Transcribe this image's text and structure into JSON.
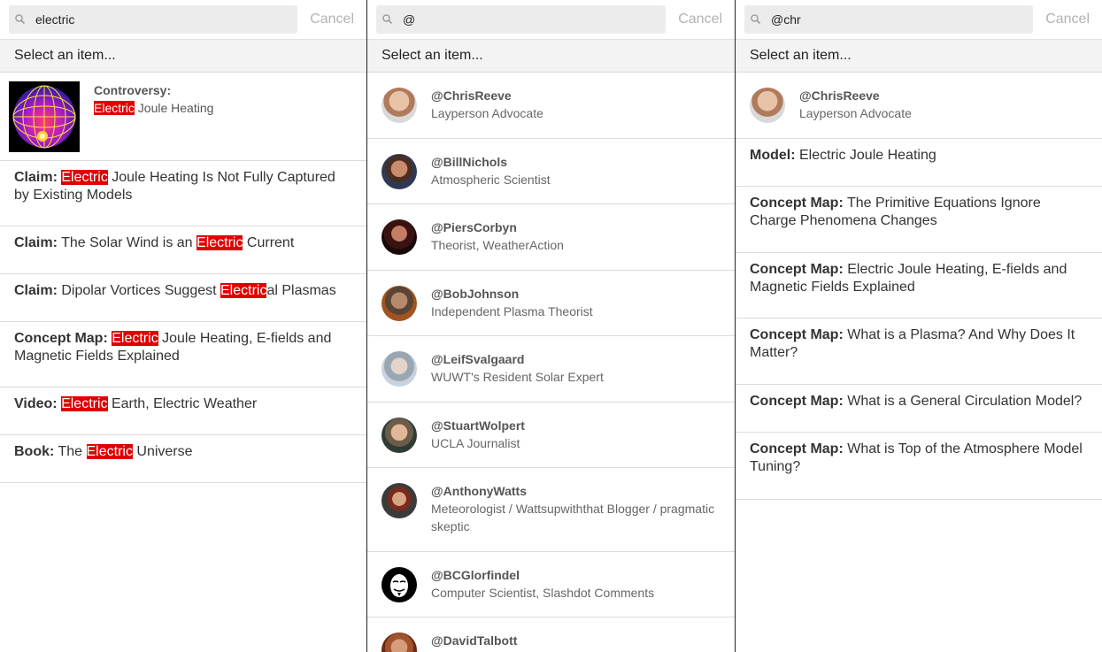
{
  "panels": [
    {
      "search": {
        "value": "electric",
        "cancel": "Cancel"
      },
      "header": "Select an item...",
      "controversy": {
        "label": "Controversy:",
        "hl": "Electric",
        "rest": " Joule Heating"
      },
      "items": [
        {
          "type": "Claim:",
          "pre": " ",
          "hl": "Electric",
          "post": " Joule Heating Is Not Fully Captured by Existing Models"
        },
        {
          "type": "Claim:",
          "pre": " The Solar Wind is an ",
          "hl": "Electric",
          "post": " Current"
        },
        {
          "type": "Claim:",
          "pre": " Dipolar Vortices Suggest ",
          "hl": "Electric",
          "post": "al Plasmas"
        },
        {
          "type": "Concept Map:",
          "pre": " ",
          "hl": "Electric",
          "post": " Joule Heating, E-fields and Magnetic Fields Explained"
        },
        {
          "type": "Video:",
          "pre": " ",
          "hl": "Electric",
          "post": " Earth, Electric Weather"
        },
        {
          "type": "Book:",
          "pre": " The ",
          "hl": "Electric",
          "post": " Universe"
        }
      ]
    },
    {
      "search": {
        "value": "@",
        "cancel": "Cancel"
      },
      "header": "Select an item...",
      "people": [
        {
          "handle": "@ChrisReeve",
          "role": "Layperson Advocate"
        },
        {
          "handle": "@BillNichols",
          "role": "Atmospheric Scientist"
        },
        {
          "handle": "@PiersCorbyn",
          "role": "Theorist, WeatherAction"
        },
        {
          "handle": "@BobJohnson",
          "role": "Independent Plasma Theorist"
        },
        {
          "handle": "@LeifSvalgaard",
          "role": "WUWT's Resident Solar Expert"
        },
        {
          "handle": "@StuartWolpert",
          "role": "UCLA Journalist"
        },
        {
          "handle": "@AnthonyWatts",
          "role": "Meteorologist / Wattsupwiththat Blogger / pragmatic skeptic"
        },
        {
          "handle": "@BCGlorfindel",
          "role": "Computer Scientist, Slashdot Comments"
        },
        {
          "handle": "@DavidTalbott",
          "role": ""
        }
      ]
    },
    {
      "search": {
        "value": "@chr",
        "cancel": "Cancel"
      },
      "header": "Select an item...",
      "person": {
        "handle": "@ChrisReeve",
        "role": "Layperson Advocate"
      },
      "items": [
        {
          "type": "Model:",
          "text": " Electric Joule Heating"
        },
        {
          "type": "Concept Map:",
          "text": " The Primitive Equations Ignore Charge Phenomena Changes"
        },
        {
          "type": "Concept Map:",
          "text": " Electric Joule Heating, E-fields and Magnetic Fields Explained"
        },
        {
          "type": "Concept Map:",
          "text": " What is a Plasma? And Why Does It Matter?"
        },
        {
          "type": "Concept Map:",
          "text": " What is a General Circulation Model?"
        },
        {
          "type": "Concept Map:",
          "text": " What is Top of the Atmosphere Model Tuning?"
        }
      ]
    }
  ]
}
